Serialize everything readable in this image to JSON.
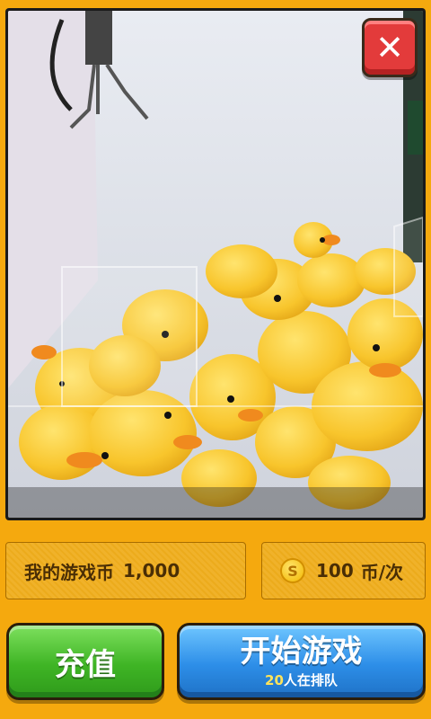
{
  "close_button": {
    "symbol": "✕",
    "icon": "close-icon",
    "color": "#e33b3b"
  },
  "coins": {
    "label": "我的游戏币",
    "value": "1,000"
  },
  "price": {
    "icon": "coin-icon",
    "coin_symbol": "S",
    "amount": "100",
    "unit": "币/次"
  },
  "recharge_button": {
    "label": "充值",
    "color": "#3fb525"
  },
  "start_button": {
    "label": "开始游戏",
    "queue_count": "20",
    "queue_text": "人在排队",
    "color": "#2d8ee8"
  },
  "colors": {
    "background": "#f5a90e",
    "accent": "#ffe35a"
  }
}
